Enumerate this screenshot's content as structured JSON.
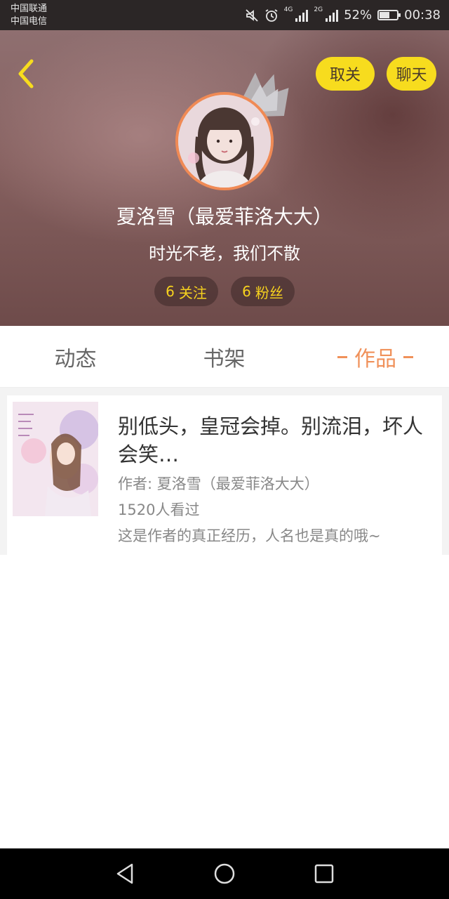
{
  "status_bar": {
    "carrier_1": "中国联通",
    "carrier_2": "中国电信",
    "net_1": "4G",
    "net_2": "2G",
    "battery": "52%",
    "time": "00:38"
  },
  "header": {
    "unfollow_label": "取关",
    "chat_label": "聊天",
    "display_name": "夏洛雪（最爱菲洛大大）",
    "signature": "时光不老，我们不散",
    "following_count": "6",
    "following_label": "关注",
    "fans_count": "6",
    "fans_label": "粉丝"
  },
  "tabs": [
    {
      "label": "动态",
      "active": false
    },
    {
      "label": "书架",
      "active": false
    },
    {
      "label": "作品",
      "active": true
    }
  ],
  "works": [
    {
      "title": "别低头，皇冠会掉。别流泪，坏人会笑…",
      "author": "作者: 夏洛雪（最爱菲洛大大）",
      "views": "1520人看过",
      "description": "这是作者的真正经历，人名也是真的哦~"
    }
  ],
  "colors": {
    "accent_orange": "#f0915a",
    "button_yellow": "#f7dc1e"
  }
}
